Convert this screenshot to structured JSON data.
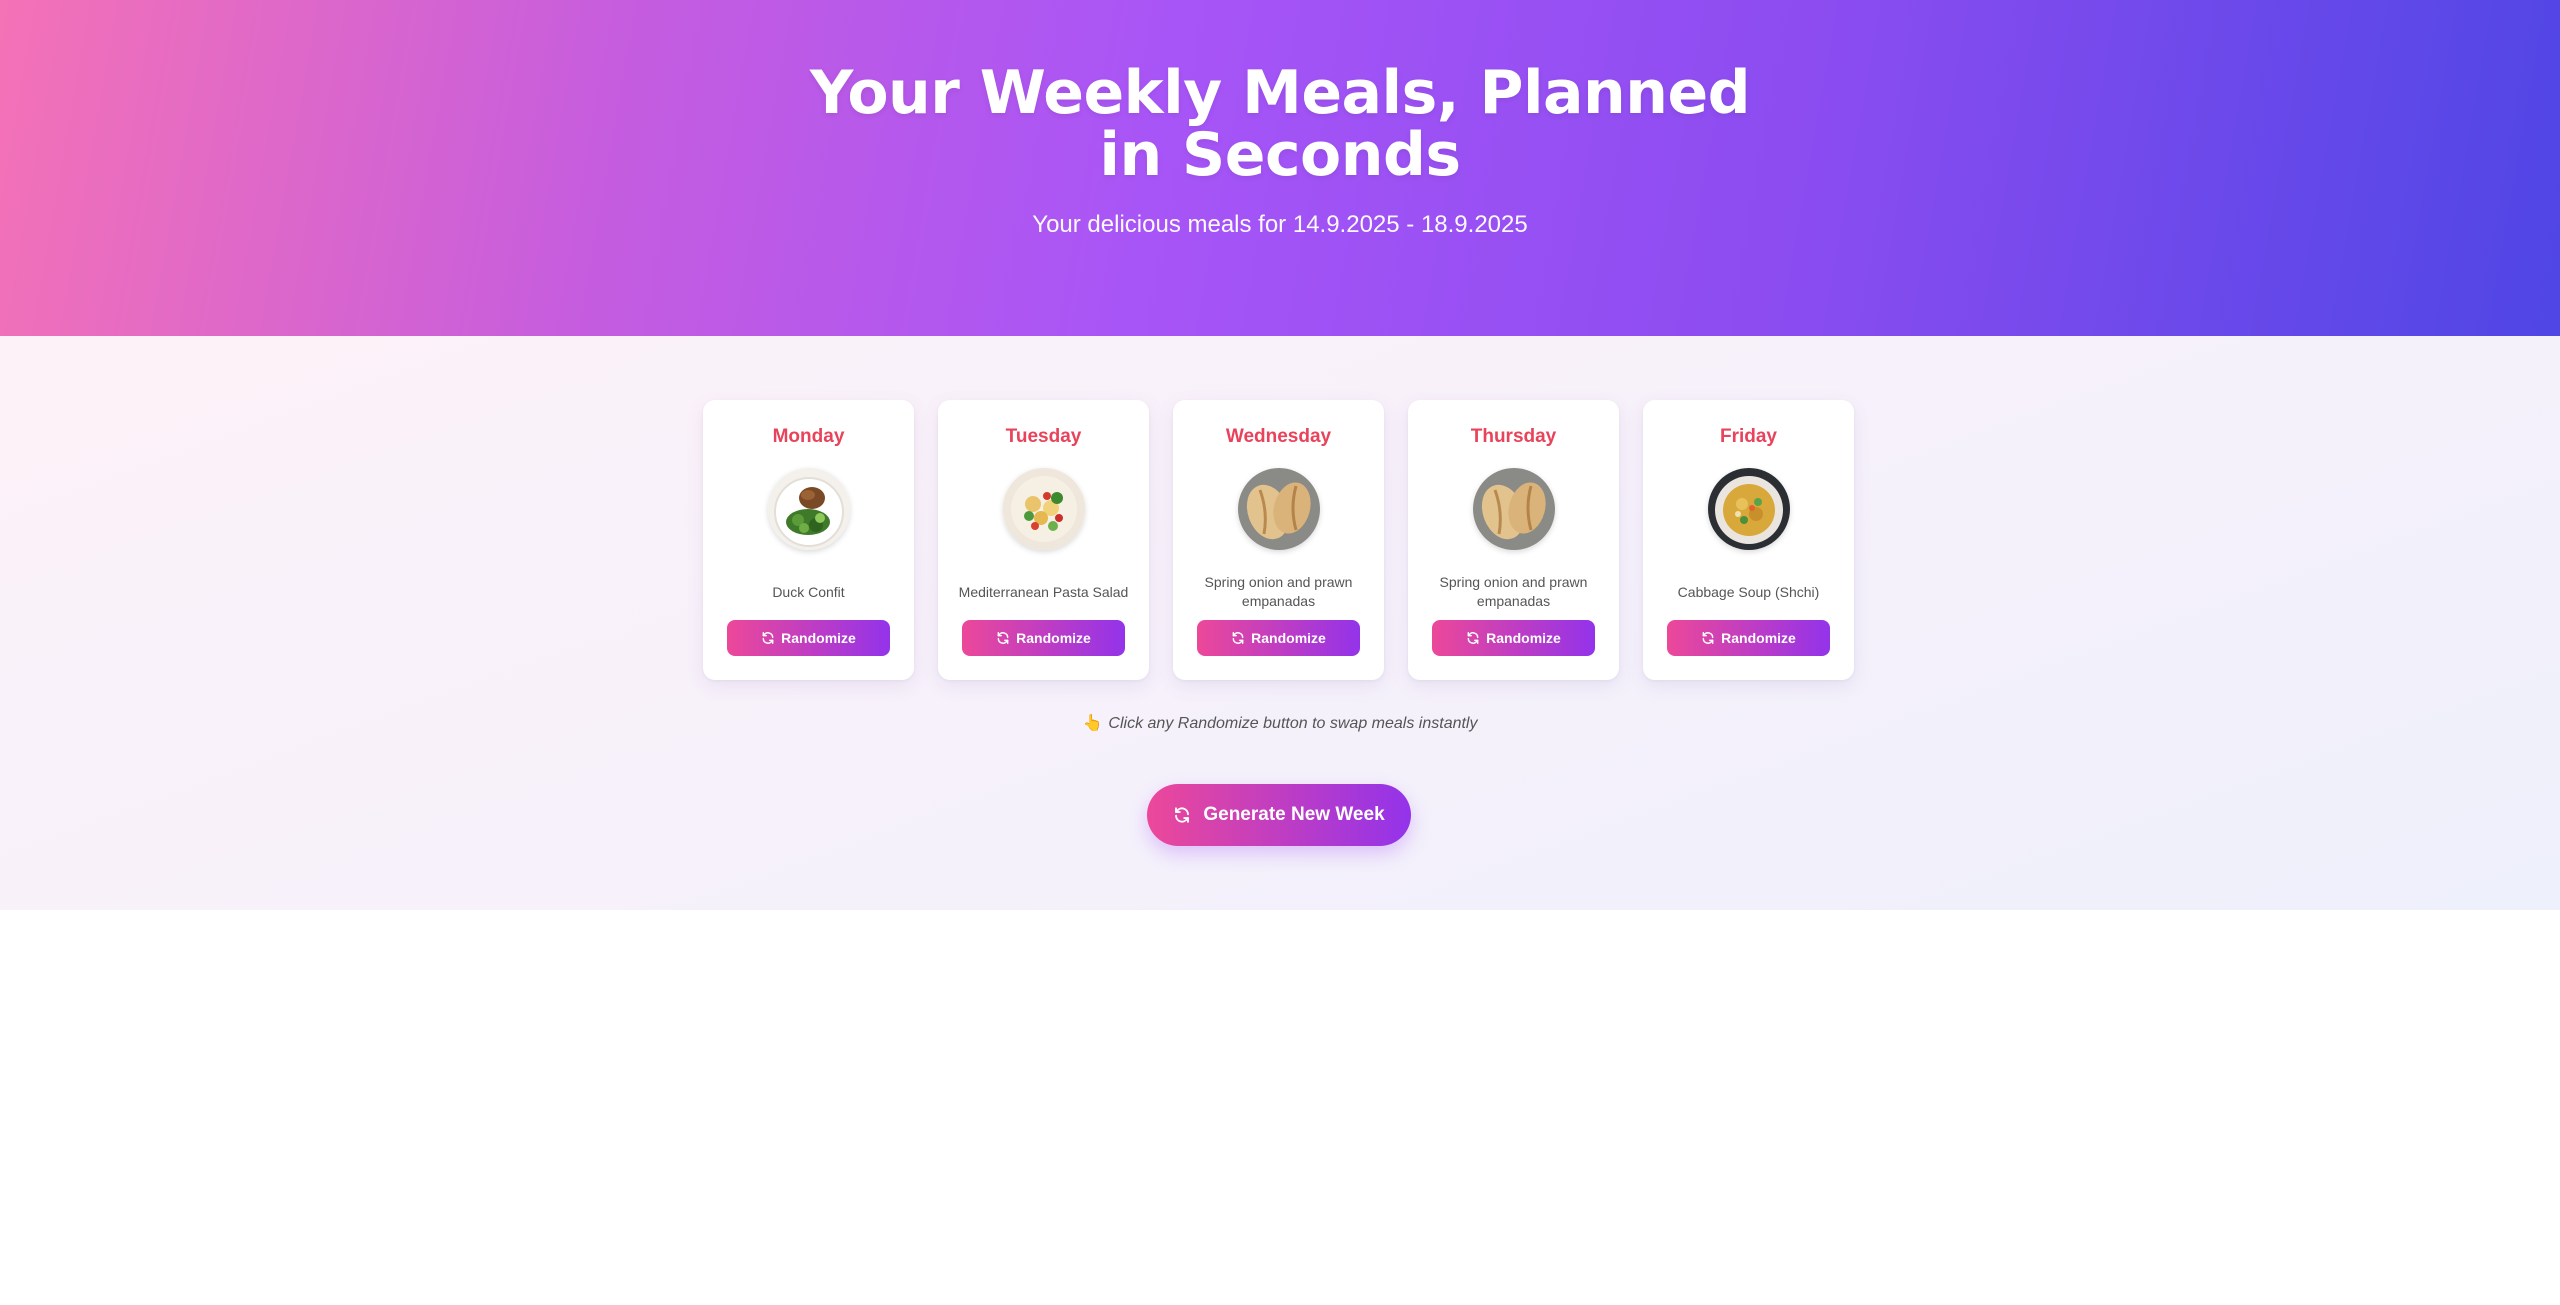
{
  "hero": {
    "title": "Your Weekly Meals, Planned in Seconds",
    "subtitle": "Your delicious meals for 14.9.2025 - 18.9.2025"
  },
  "days": [
    {
      "day": "Monday",
      "meal": "Duck Confit",
      "button": "Randomize"
    },
    {
      "day": "Tuesday",
      "meal": "Mediterranean Pasta Salad",
      "button": "Randomize"
    },
    {
      "day": "Wednesday",
      "meal": "Spring onion and prawn empanadas",
      "button": "Randomize"
    },
    {
      "day": "Thursday",
      "meal": "Spring onion and prawn empanadas",
      "button": "Randomize"
    },
    {
      "day": "Friday",
      "meal": "Cabbage Soup (Shchi)",
      "button": "Randomize"
    }
  ],
  "hint": "Click any Randomize button to swap meals instantly",
  "generate_button": "Generate New Week",
  "colors": {
    "accent_pink": "#ec4899",
    "accent_purple": "#9333ea",
    "day_label": "#e8435a"
  }
}
